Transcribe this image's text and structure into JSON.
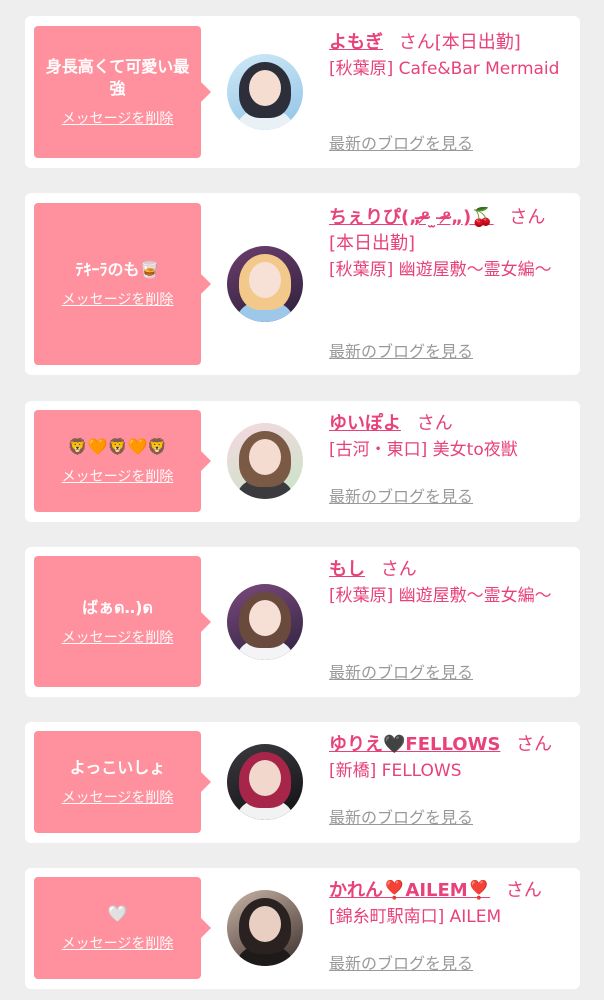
{
  "cards": [
    {
      "message": "身長高くて可愛い最強",
      "delete_label": "メッセージを削除",
      "name": "よもぎ",
      "honorific": "さん",
      "status": "[本日出勤]",
      "shop": "[秋葉原] Cafe&Bar Mermaid",
      "blog_label": "最新のブログを見る"
    },
    {
      "message": "ﾃｷｰﾗのも🥃",
      "delete_label": "メッセージを削除",
      "name": "ちぇりぴ(„ᵒ̴̶̷ ̫ ᵒ̴̶̷„)🍒",
      "honorific": "さん",
      "status": "[本日出勤]",
      "shop": "[秋葉原] 幽遊屋敷〜霊女編〜",
      "blog_label": "最新のブログを見る"
    },
    {
      "message": "🦁🧡🦁🧡🦁",
      "delete_label": "メッセージを削除",
      "name": "ゆいぽよ",
      "honorific": "さん",
      "status": "",
      "shop": "[古河・東口] 美女to夜獣",
      "blog_label": "最新のブログを見る"
    },
    {
      "message": "ばぁด‥)ด",
      "delete_label": "メッセージを削除",
      "name": "もし",
      "honorific": "さん",
      "status": "",
      "shop": "[秋葉原] 幽遊屋敷〜霊女編〜",
      "blog_label": "最新のブログを見る"
    },
    {
      "message": "よっこいしょ",
      "delete_label": "メッセージを削除",
      "name": "ゆりえ🖤FELLOWS",
      "honorific": "さん",
      "status": "",
      "shop": "[新橋] FELLOWS",
      "blog_label": "最新のブログを見る"
    },
    {
      "message": "🤍",
      "delete_label": "メッセージを削除",
      "name": "かれん❣️AILEM❣️",
      "honorific": "さん",
      "status": "",
      "shop": "[錦糸町駅南口] AILEM",
      "blog_label": "最新のブログを見る"
    }
  ],
  "colors": {
    "accent": "#e8427a",
    "bubble": "#ff919e",
    "background": "#eeeeee",
    "link_gray": "#999999"
  },
  "icons": {
    "avatar": "profile-photo"
  }
}
